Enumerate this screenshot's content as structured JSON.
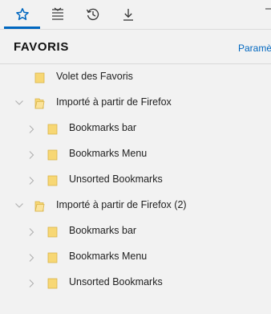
{
  "toolbar": {
    "buttons": [
      {
        "name": "favorites-star-icon"
      },
      {
        "name": "reading-list-icon"
      },
      {
        "name": "history-icon"
      },
      {
        "name": "downloads-icon"
      }
    ],
    "accent_color": "#0067c0"
  },
  "header": {
    "title": "FAVORIS",
    "settings_link": "Paramè"
  },
  "tree": [
    {
      "label": "Volet des Favoris",
      "level": 0,
      "has_children": false
    },
    {
      "label": "Importé à partir de Firefox",
      "level": 0,
      "has_children": true,
      "expanded": true
    },
    {
      "label": "Bookmarks bar",
      "level": 1,
      "has_children": true,
      "expanded": false
    },
    {
      "label": "Bookmarks Menu",
      "level": 1,
      "has_children": true,
      "expanded": false
    },
    {
      "label": "Unsorted Bookmarks",
      "level": 1,
      "has_children": true,
      "expanded": false
    },
    {
      "label": "Importé à partir de Firefox (2)",
      "level": 0,
      "has_children": true,
      "expanded": true
    },
    {
      "label": "Bookmarks bar",
      "level": 1,
      "has_children": true,
      "expanded": false
    },
    {
      "label": "Bookmarks Menu",
      "level": 1,
      "has_children": true,
      "expanded": false
    },
    {
      "label": "Unsorted Bookmarks",
      "level": 1,
      "has_children": true,
      "expanded": false
    }
  ],
  "colors": {
    "folder": "#f7d774",
    "folder_edge": "#d9b44a",
    "link": "#0067c0"
  }
}
